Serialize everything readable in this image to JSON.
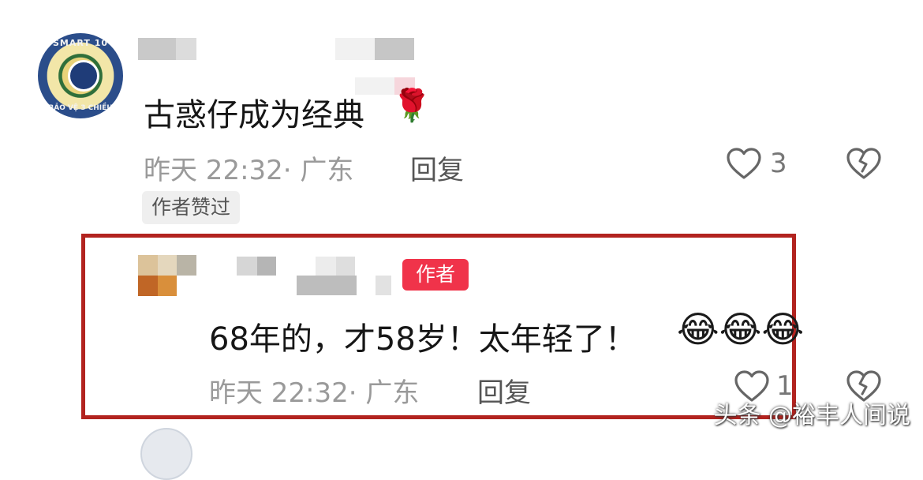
{
  "comment1": {
    "text": "古惑仔成为经典",
    "time_location": "昨天 22:32· 广东",
    "reply_label": "回复",
    "like_count": "3",
    "liked_by_author_label": "作者赞过",
    "avatar_text_top": "SMART 10",
    "avatar_text_bottom": "BẢO VỆ 3 CHIỀU",
    "emoji": "🌹"
  },
  "comment2": {
    "author_badge": "作者",
    "text": "68年的，才58岁！太年轻了！",
    "emojis": "😂😂😂",
    "time_location": "昨天 22:32· 广东",
    "reply_label": "回复",
    "like_count": "1"
  },
  "watermark": "头条 @裕丰人间说",
  "colors": {
    "highlight_border": "#b2231f",
    "author_badge_bg": "#f0334a",
    "meta_text": "#9a9a9a"
  },
  "icons": [
    "heart-outline-icon",
    "broken-heart-icon"
  ]
}
